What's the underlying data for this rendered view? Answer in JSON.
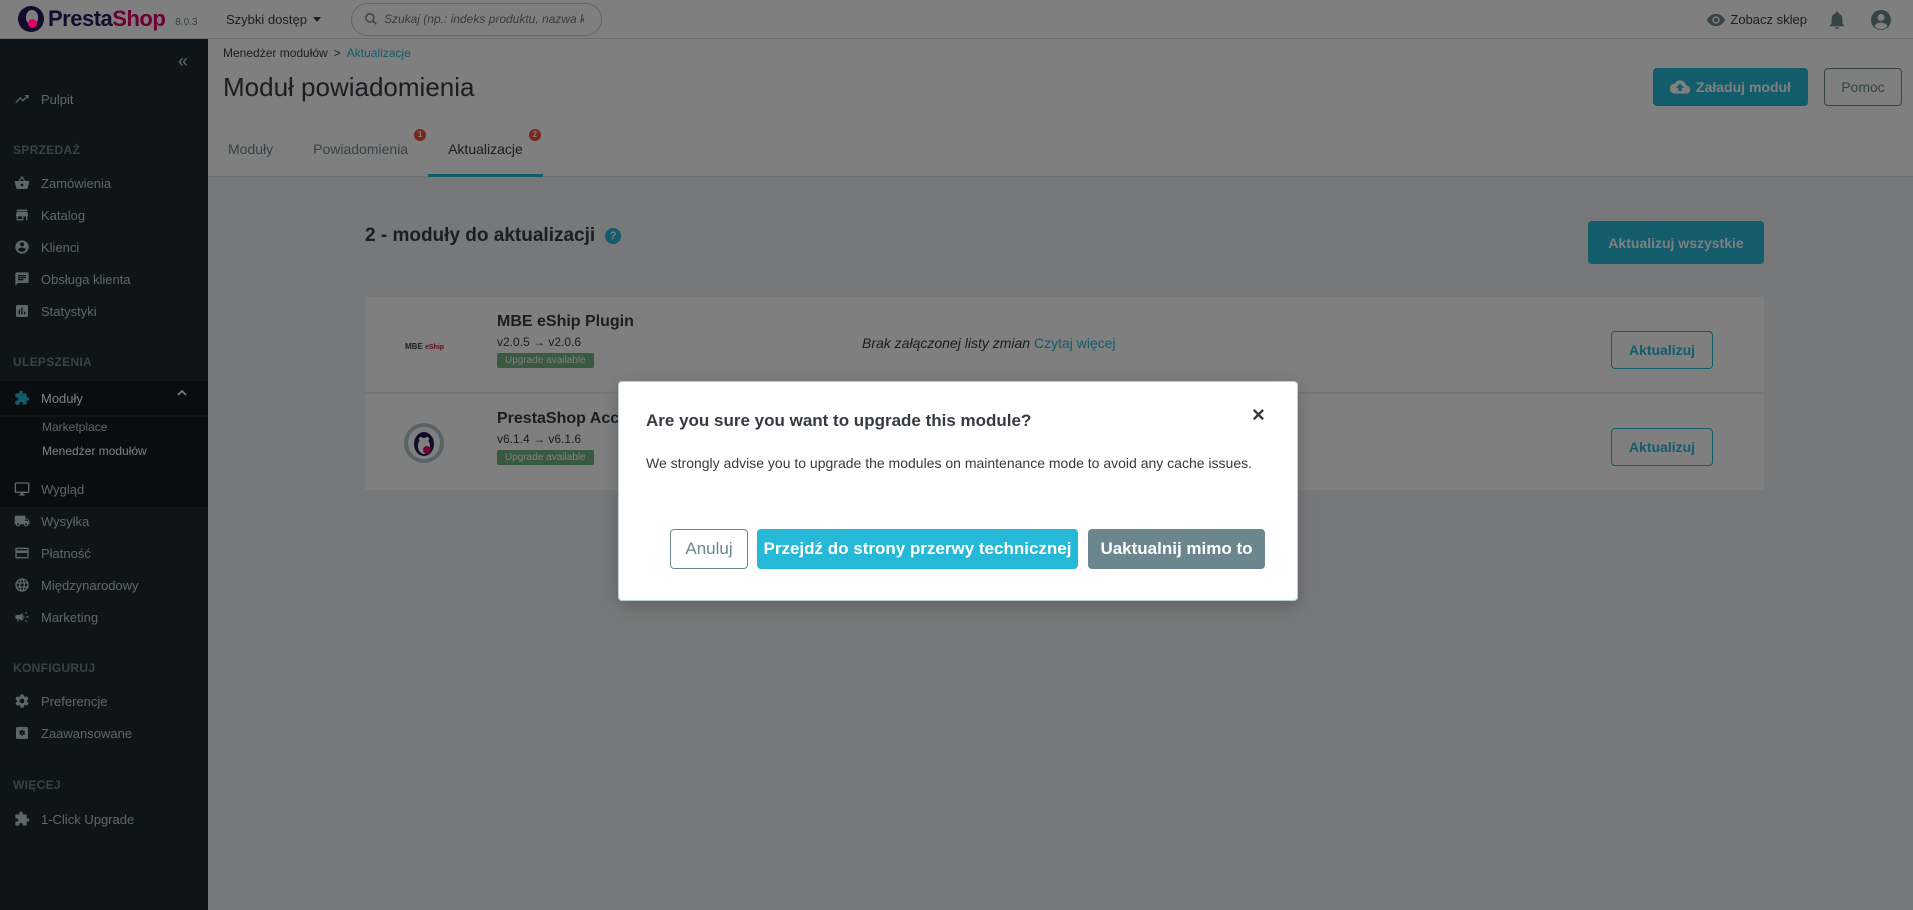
{
  "header": {
    "logo_part1": "Presta",
    "logo_part2": "Shop",
    "version": "8.0.3",
    "quick_access": "Szybki dostęp",
    "search_placeholder": "Szukaj (np.: indeks produktu, nazwa k",
    "view_shop": "Zobacz sklep"
  },
  "sidebar": {
    "dashboard": "Pulpit",
    "sections": {
      "sales": "SPRZEDAŻ",
      "improve": "ULEPSZENIA",
      "configure": "KONFIGURUJ",
      "more": "WIĘCEJ"
    },
    "items": {
      "orders": "Zamówienia",
      "catalog": "Katalog",
      "customers": "Klienci",
      "customer_service": "Obsługa klienta",
      "stats": "Statystyki",
      "modules": "Moduły",
      "marketplace": "Marketplace",
      "module_manager": "Menedżer modułów",
      "design": "Wygląd",
      "shipping": "Wysyłka",
      "payment": "Płatność",
      "international": "Międzynarodowy",
      "marketing": "Marketing",
      "preferences": "Preferencje",
      "advanced": "Zaawansowane",
      "one_click": "1-Click Upgrade"
    }
  },
  "page": {
    "breadcrumb_parent": "Menedżer modułów",
    "breadcrumb_sep": ">",
    "breadcrumb_current": "Aktualizacje",
    "title": "Moduł powiadomienia",
    "upload_button": "Załaduj moduł",
    "help_button": "Pomoc",
    "tabs": [
      {
        "label": "Moduły",
        "badge": ""
      },
      {
        "label": "Powiadomienia",
        "badge": "1"
      },
      {
        "label": "Aktualizacje",
        "badge": "2"
      }
    ]
  },
  "main": {
    "section_title": "2 - moduły do aktualizacji",
    "help_icon": "?",
    "update_all": "Aktualizuj wszystkie",
    "modules": [
      {
        "name": "MBE eShip Plugin",
        "version": "v2.0.5 → v2.0.6",
        "badge": "Upgrade available",
        "changelog": "Brak załączonej listy zmian",
        "read_more": "Czytaj więcej",
        "button": "Aktualizuj"
      },
      {
        "name": "PrestaShop Acc",
        "version": "v6.1.4 → v6.1.6",
        "badge": "Upgrade available",
        "button": "Aktualizuj"
      }
    ]
  },
  "modal": {
    "title": "Are you sure you want to upgrade this module?",
    "close": "×",
    "body": "We strongly advise you to upgrade the modules on maintenance mode to avoid any cache issues.",
    "cancel": "Anuluj",
    "maintenance": "Przejdź do strony przerwy technicznej",
    "upgrade": "Uaktualnij mimo to"
  },
  "colors": {
    "accent": "#25b9d7",
    "sidebar_bg": "#1c2a32",
    "badge_green": "#70b580",
    "badge_red": "#f54c3e"
  }
}
